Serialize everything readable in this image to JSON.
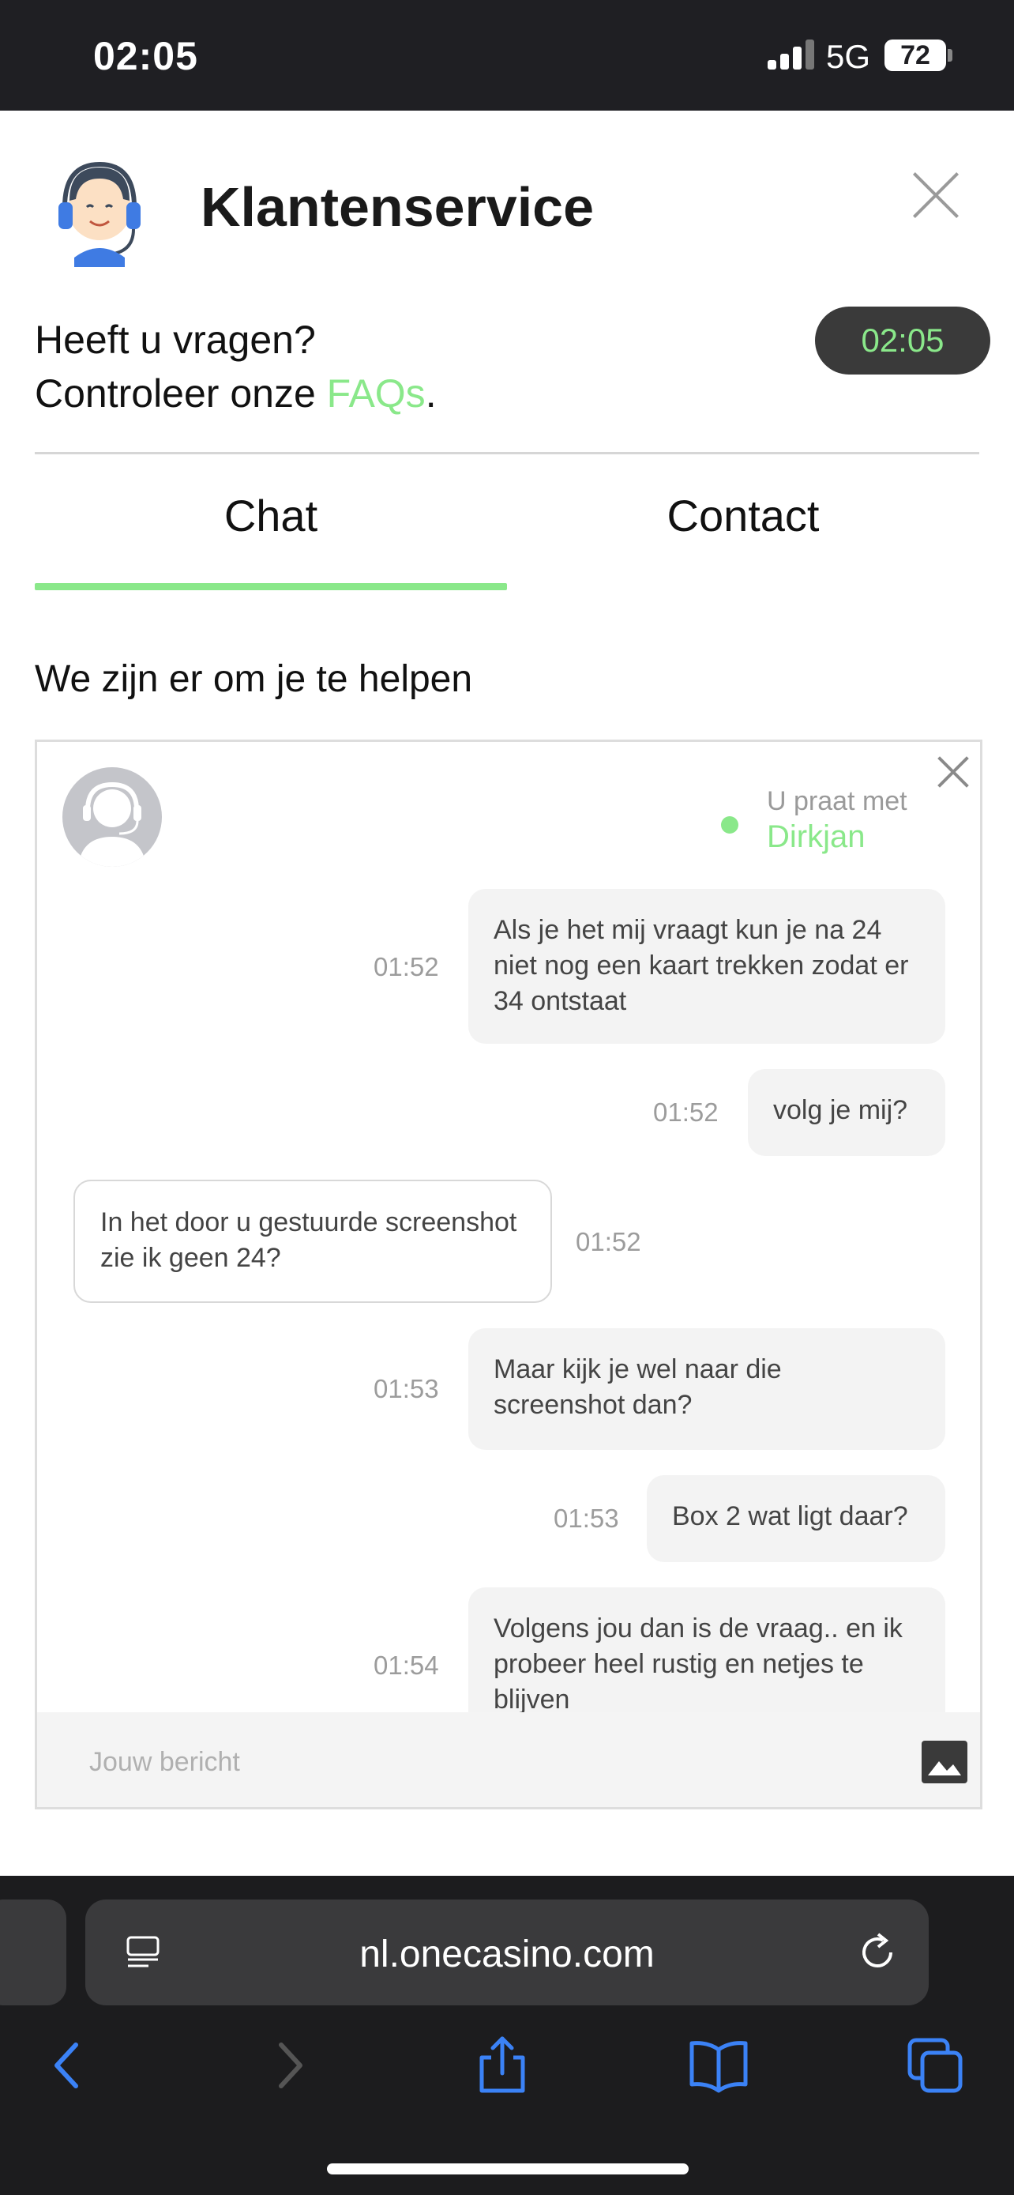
{
  "status_bar": {
    "time": "02:05",
    "network": "5G",
    "battery": "72"
  },
  "header": {
    "title": "Klantenservice"
  },
  "faq": {
    "line1": "Heeft u vragen?",
    "line2_prefix": "Controleer onze ",
    "link": "FAQs",
    "line2_suffix": "."
  },
  "timer": "02:05",
  "tabs": [
    {
      "label": "Chat",
      "active": true
    },
    {
      "label": "Contact",
      "active": false
    }
  ],
  "help_text": "We zijn er om je te helpen",
  "chat": {
    "talking_to_label": "U praat met",
    "agent_name": "Dirkjan",
    "messages": [
      {
        "from": "user",
        "time": "01:52",
        "text": "Als je het mij vraagt kun je na 24 niet nog een kaart trekken zodat er 34 ontstaat"
      },
      {
        "from": "user",
        "time": "01:52",
        "text": "volg je mij?"
      },
      {
        "from": "agent",
        "time": "01:52",
        "text": "In het door u gestuurde screenshot zie ik geen 24?"
      },
      {
        "from": "user",
        "time": "01:53",
        "text": "Maar kijk je wel naar die screenshot dan?"
      },
      {
        "from": "user",
        "time": "01:53",
        "text": "Box 2 wat ligt daar?"
      },
      {
        "from": "user",
        "time": "01:54",
        "text": "Volgens jou dan is de vraag.. en ik probeer heel rustig en netjes te blijven"
      }
    ],
    "input_placeholder": "Jouw bericht"
  },
  "browser": {
    "url": "nl.onecasino.com"
  },
  "colors": {
    "accent": "#8ae88a",
    "status_bg": "#1f1f23",
    "browser_bg": "#1c1c1e",
    "ios_blue": "#3b82f6"
  }
}
